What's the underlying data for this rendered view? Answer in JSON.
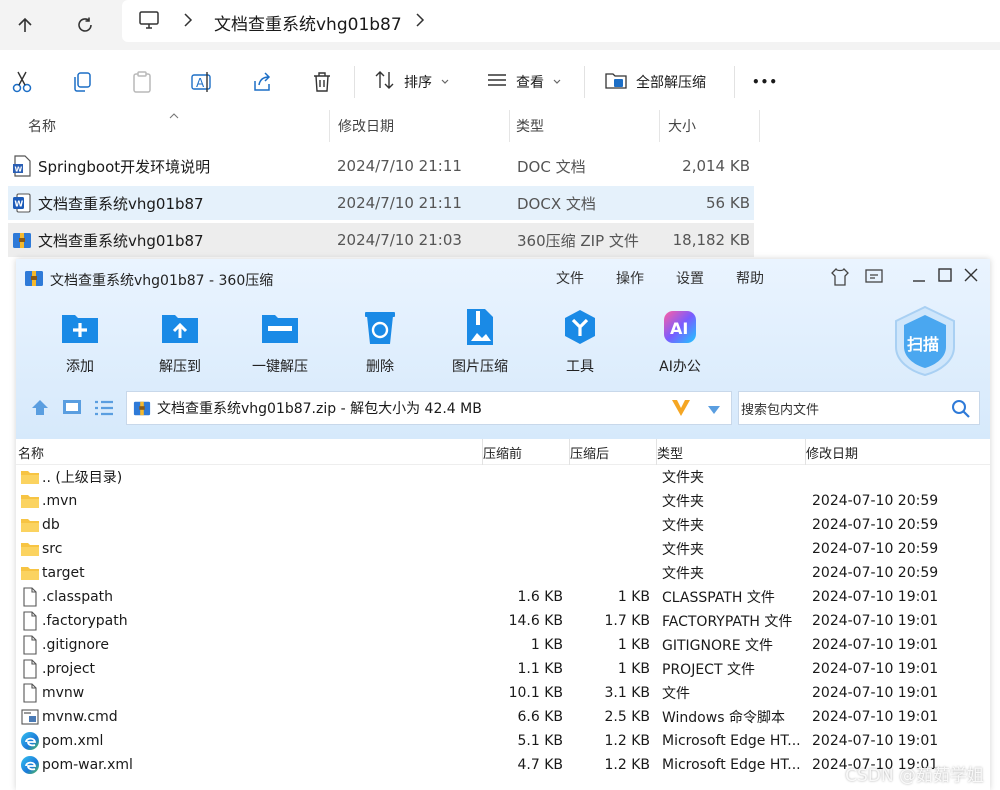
{
  "explorer": {
    "breadcrumb": {
      "folder": "文档查重系统vhg01b87"
    },
    "commands": {
      "sort_label": "排序",
      "view_label": "查看",
      "extract_all_label": "全部解压缩",
      "more_label": "•••"
    },
    "columns": {
      "name": "名称",
      "modified": "修改日期",
      "type": "类型",
      "size": "大小"
    },
    "files": [
      {
        "name": "Springboot开发环境说明",
        "modified": "2024/7/10 21:11",
        "type": "DOC 文档",
        "size": "2,014 KB",
        "icon": "word-doc-icon"
      },
      {
        "name": "文档查重系统vhg01b87",
        "modified": "2024/7/10 21:11",
        "type": "DOCX 文档",
        "size": "56 KB",
        "icon": "word-docx-icon"
      },
      {
        "name": "文档查重系统vhg01b87",
        "modified": "2024/7/10 21:03",
        "type": "360压缩 ZIP 文件",
        "size": "18,182 KB",
        "icon": "zip-archive-icon"
      }
    ]
  },
  "zip": {
    "title": "文档查重系统vhg01b87 - 360压缩",
    "menu": [
      "文件",
      "操作",
      "设置",
      "帮助"
    ],
    "toolbar": [
      "添加",
      "解压到",
      "一键解压",
      "删除",
      "图片压缩",
      "工具",
      "AI办公"
    ],
    "scan_label": "扫描",
    "path_text": "文档查重系统vhg01b87.zip - 解包大小为 42.4 MB",
    "search_placeholder": "搜索包内文件",
    "columns": {
      "name": "名称",
      "before": "压缩前",
      "after": "压缩后",
      "type": "类型",
      "modified": "修改日期"
    },
    "rows": [
      {
        "name": ".. (上级目录)",
        "before": "",
        "after": "",
        "type": "文件夹",
        "modified": "",
        "icon": "folder-icon"
      },
      {
        "name": ".mvn",
        "before": "",
        "after": "",
        "type": "文件夹",
        "modified": "2024-07-10 20:59",
        "icon": "folder-icon"
      },
      {
        "name": "db",
        "before": "",
        "after": "",
        "type": "文件夹",
        "modified": "2024-07-10 20:59",
        "icon": "folder-icon"
      },
      {
        "name": "src",
        "before": "",
        "after": "",
        "type": "文件夹",
        "modified": "2024-07-10 20:59",
        "icon": "folder-icon"
      },
      {
        "name": "target",
        "before": "",
        "after": "",
        "type": "文件夹",
        "modified": "2024-07-10 20:59",
        "icon": "folder-icon"
      },
      {
        "name": ".classpath",
        "before": "1.6 KB",
        "after": "1 KB",
        "type": "CLASSPATH 文件",
        "modified": "2024-07-10 19:01",
        "icon": "file-icon"
      },
      {
        "name": ".factorypath",
        "before": "14.6 KB",
        "after": "1.7 KB",
        "type": "FACTORYPATH 文件",
        "modified": "2024-07-10 19:01",
        "icon": "file-icon"
      },
      {
        "name": ".gitignore",
        "before": "1 KB",
        "after": "1 KB",
        "type": "GITIGNORE 文件",
        "modified": "2024-07-10 19:01",
        "icon": "file-icon"
      },
      {
        "name": ".project",
        "before": "1.1 KB",
        "after": "1 KB",
        "type": "PROJECT 文件",
        "modified": "2024-07-10 19:01",
        "icon": "file-icon"
      },
      {
        "name": "mvnw",
        "before": "10.1 KB",
        "after": "3.1 KB",
        "type": "文件",
        "modified": "2024-07-10 19:01",
        "icon": "file-icon"
      },
      {
        "name": "mvnw.cmd",
        "before": "6.6 KB",
        "after": "2.5 KB",
        "type": "Windows 命令脚本",
        "modified": "2024-07-10 19:01",
        "icon": "cmd-script-icon"
      },
      {
        "name": "pom.xml",
        "before": "5.1 KB",
        "after": "1.2 KB",
        "type": "Microsoft Edge HT...",
        "modified": "2024-07-10 19:01",
        "icon": "edge-icon"
      },
      {
        "name": "pom-war.xml",
        "before": "4.7 KB",
        "after": "1.2 KB",
        "type": "Microsoft Edge HT...",
        "modified": "2024-07-10 19:01",
        "icon": "edge-icon"
      }
    ]
  },
  "watermark": "CSDN @茹茹学姐",
  "colors": {
    "selected_row": "#e5f1fb",
    "hover_row": "#ededed",
    "zip_blue": "#1a8ae6",
    "folder_yellow": "#f7c443"
  }
}
